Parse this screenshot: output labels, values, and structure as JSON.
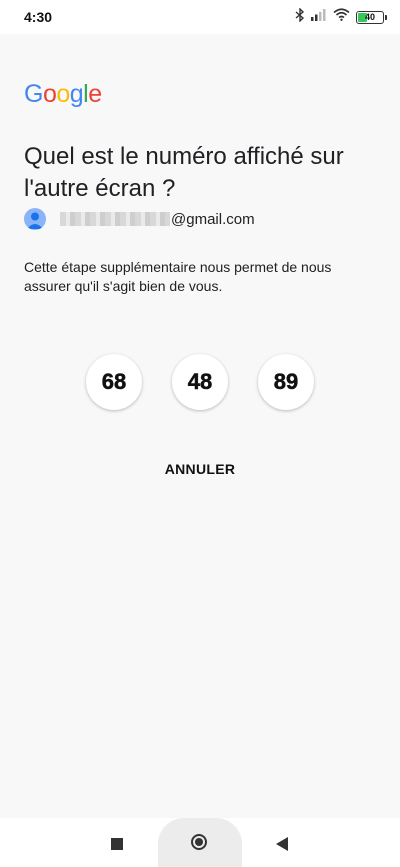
{
  "status_bar": {
    "time": "4:30",
    "battery_level": "40",
    "battery_fraction": 0.4,
    "icons": [
      "bluetooth-icon",
      "signal-icon",
      "wifi-icon",
      "battery-icon"
    ]
  },
  "logo": {
    "letters": [
      "G",
      "o",
      "o",
      "g",
      "l",
      "e"
    ],
    "colors": [
      "#4285F4",
      "#EA4335",
      "#FBBC05",
      "#4285F4",
      "#34A853",
      "#EA4335"
    ]
  },
  "title": "Quel est le numéro affiché sur l'autre écran ?",
  "account": {
    "email_domain": "@gmail.com"
  },
  "description": "Cette étape supplémentaire nous permet de nous assurer qu'il s'agit bien de vous.",
  "numbers": [
    "68",
    "48",
    "89"
  ],
  "cancel_label": "ANNULER",
  "nav": {
    "icons": [
      "recent-apps-icon",
      "home-icon",
      "back-icon"
    ]
  },
  "colors": {
    "battery_fill": "#37c75a",
    "avatar": "#8ab4f8"
  }
}
